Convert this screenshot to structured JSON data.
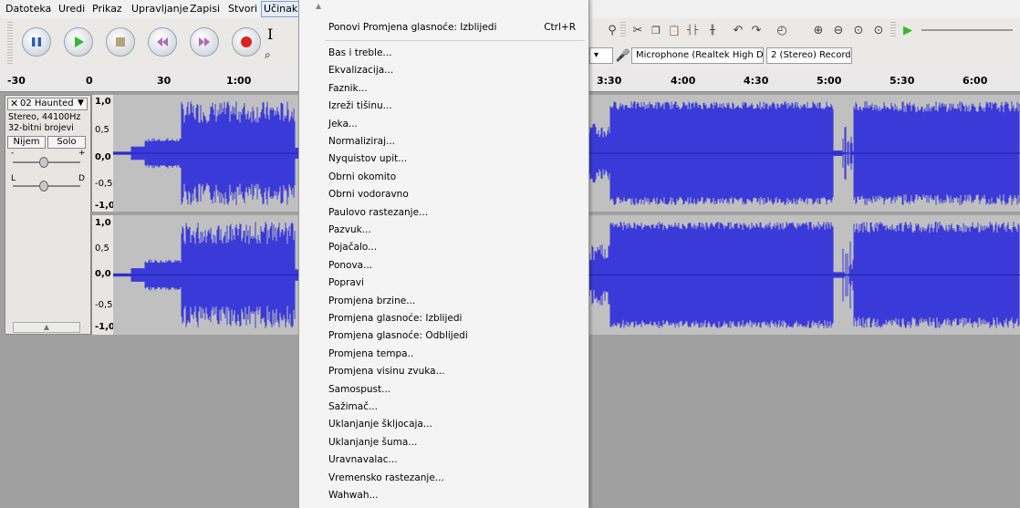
{
  "menubar": {
    "items": [
      "Datoteka",
      "Uredi",
      "Prikaz",
      "Upravljanje",
      "Zapisi",
      "Stvori",
      "Učinak"
    ]
  },
  "device": {
    "input_device": "Microphone (Realtek High Defi",
    "channels": "2 (Stereo) Record"
  },
  "ruler": {
    "labels": [
      "-30",
      "0",
      "30",
      "1:00",
      "3:30",
      "4:00",
      "4:30",
      "5:00",
      "5:30",
      "6:00"
    ]
  },
  "track": {
    "name": "02 Haunted",
    "format": "Stereo, 44100Hz",
    "bits": "32-bitni brojevi",
    "mute": "Nijem",
    "solo": "Solo",
    "gain_minus": "-",
    "gain_plus": "+",
    "pan_left": "L",
    "pan_right": "D",
    "scale": [
      "1,0",
      "0,5",
      "0,0",
      "-0,5",
      "-1,0"
    ]
  },
  "menu": {
    "repeat_label": "Ponovi Promjena glasnoće: Izblijedi",
    "repeat_shortcut": "Ctrl+R",
    "items": [
      "Bas i treble...",
      "Ekvalizacija...",
      "Faznik...",
      "Izreži tišinu...",
      "Jeka...",
      "Normaliziraj...",
      "Nyquistov upit...",
      "Obrni okomito",
      "Obrni vodoravno",
      "Paulovo rastezanje...",
      "Pazvuk...",
      "Pojačalo...",
      "Ponova...",
      "Popravi",
      "Promjena brzine...",
      "Promjena glasnoće: Izblijedi",
      "Promjena glasnoće: Odblijedi",
      "Promjena tempa..",
      "Promjena visinu zvuka...",
      "Samospust...",
      "Sažimač...",
      "Uklanjanje škljocaja...",
      "Uklanjanje šuma...",
      "Uravnavalac...",
      "Vremensko rastezanje...",
      "Wahwah..."
    ]
  },
  "colors": {
    "waveform": "#3a3ad8",
    "wave_bg": "#c0c0c0",
    "play_green": "#33b833",
    "record_red": "#dd2222"
  }
}
